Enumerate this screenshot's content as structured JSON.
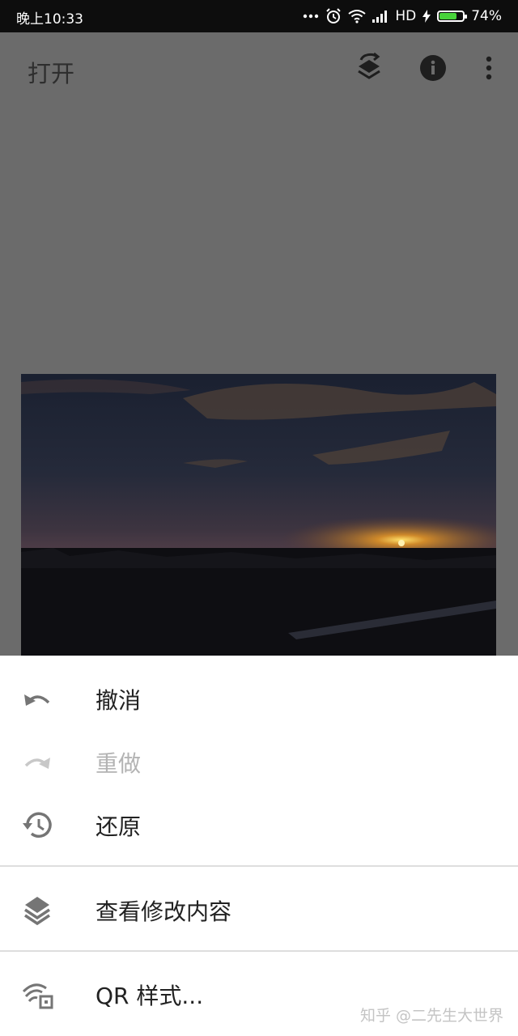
{
  "status_bar": {
    "time": "晚上10:33",
    "network": "HD",
    "battery": "74%",
    "battery_level": 0.74,
    "battery_color": "#48d33a",
    "icons": [
      "more-dots-icon",
      "alarm-icon",
      "wifi-icon",
      "signal-icon",
      "charging-bolt-icon",
      "battery-icon"
    ]
  },
  "app_bar": {
    "title": "打开",
    "actions": [
      "layers-swap-icon",
      "info-icon",
      "more-vert-icon"
    ]
  },
  "photo": {
    "description_icon": "sunset-photo"
  },
  "menu": {
    "items": [
      {
        "label": "撤消",
        "icon": "undo-icon",
        "enabled": true
      },
      {
        "label": "重做",
        "icon": "redo-icon",
        "enabled": false
      },
      {
        "label": "还原",
        "icon": "history-icon",
        "enabled": true
      },
      {
        "label": "查看修改内容",
        "icon": "layers-icon",
        "enabled": true
      },
      {
        "label": "QR 样式...",
        "icon": "qr-style-icon",
        "enabled": true
      }
    ]
  },
  "watermark": "知乎 @二先生大世界",
  "colors": {
    "scrim": "#6b6b6b",
    "status_bar": "#0d0d0d",
    "sheet": "#ffffff",
    "text": "#222222",
    "disabled_text": "#b3b3b3"
  }
}
